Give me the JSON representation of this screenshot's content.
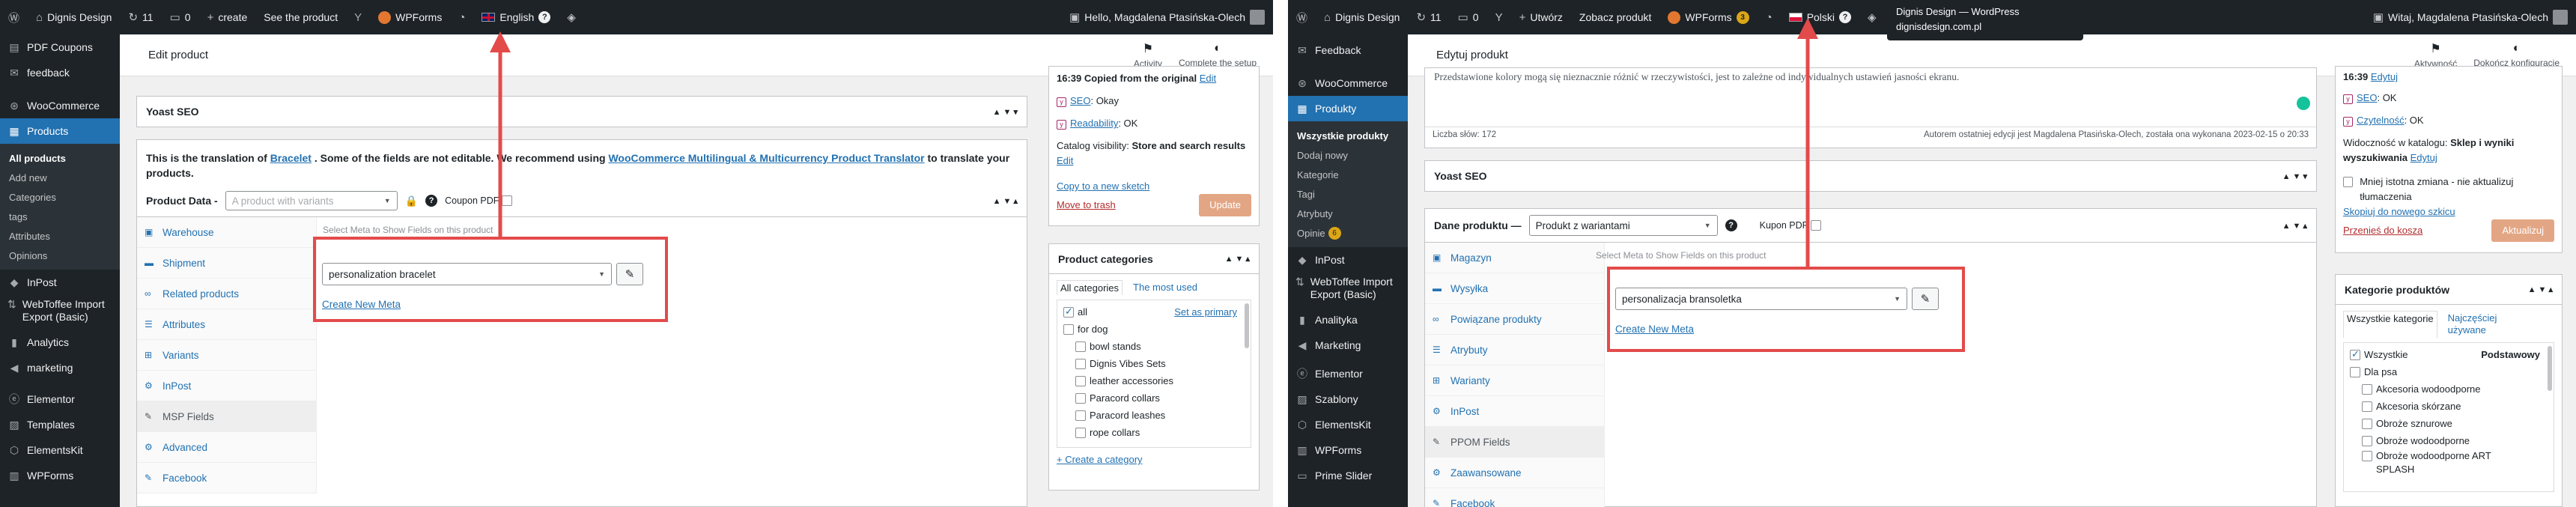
{
  "left": {
    "admin_bar": {
      "site": "Dignis Design",
      "updates": "11",
      "comments": "0",
      "new": "create",
      "view": "See the product",
      "wpforms": "WPForms",
      "language": "English",
      "greeting": "Hello, Magdalena Ptasińska-Olech"
    },
    "menu": {
      "items_top": [
        {
          "label": "PDF Coupons",
          "icon": "pdf-icon"
        },
        {
          "label": "feedback",
          "icon": "feedback-icon"
        },
        {
          "label": "WooCommerce",
          "icon": "woocommerce-icon"
        },
        {
          "label": "Products",
          "icon": "products-icon"
        }
      ],
      "submenu": [
        "All products",
        "Add new",
        "Categories",
        "tags",
        "Attributes",
        "Opinions"
      ],
      "items_bottom": [
        {
          "label": "InPost",
          "icon": "inpost-icon"
        },
        {
          "label": "WebToffee Import Export (Basic)",
          "icon": "import-export-icon"
        },
        {
          "label": "Analytics",
          "icon": "analytics-icon"
        },
        {
          "label": "marketing",
          "icon": "marketing-icon"
        },
        {
          "label": "Elementor",
          "icon": "elementor-icon"
        },
        {
          "label": "Templates",
          "icon": "templates-icon"
        },
        {
          "label": "ElementsKit",
          "icon": "elementskit-icon"
        },
        {
          "label": "WPForms",
          "icon": "wpforms-icon"
        }
      ]
    },
    "page_title": "Edit product",
    "activity": "Activity",
    "complete_setup": "Complete the setup",
    "yoast_title": "Yoast SEO",
    "translation_notice": {
      "before": "This is the translation of ",
      "link1": "Bracelet",
      "middle": " . Some of the fields are not editable. We recommend using ",
      "link2": "WooCommerce Multilingual & Multicurrency Product Translator",
      "after": " to translate your products."
    },
    "product_data_label": "Product Data -",
    "product_type": "A product with variants",
    "coupon_pdf": "Coupon PDF",
    "tabs": [
      "Warehouse",
      "Shipment",
      "Related products",
      "Attributes",
      "Variants",
      "InPost",
      "MSP Fields",
      "Advanced",
      "Facebook"
    ],
    "msp_hint": "Select Meta to Show Fields on this product",
    "meta_select": "personalization bracelet",
    "create_meta": "Create New Meta",
    "publish": {
      "copied": "16:39 Copied from the original",
      "edit": "Edit",
      "seo_label": "SEO",
      "seo_value": ": Okay",
      "readability_label": "Readability",
      "readability_value": ": OK",
      "catalog_visibility": "Catalog visibility:",
      "catalog_value": "Store and search results",
      "catalog_edit": "Edit",
      "copy_sketch": "Copy to a new sketch",
      "trash": "Move to trash",
      "update": "Update"
    },
    "categories": {
      "title": "Product categories",
      "tab_all": "All categories",
      "tab_used": "The most used",
      "set_primary": "Set as primary",
      "items": [
        {
          "label": "all",
          "checked": true,
          "level": 0
        },
        {
          "label": "for dog",
          "checked": false,
          "level": 0
        },
        {
          "label": "bowl stands",
          "checked": false,
          "level": 1
        },
        {
          "label": "Dignis Vibes Sets",
          "checked": false,
          "level": 1
        },
        {
          "label": "leather accessories",
          "checked": false,
          "level": 1
        },
        {
          "label": "Paracord collars",
          "checked": false,
          "level": 1
        },
        {
          "label": "Paracord leashes",
          "checked": false,
          "level": 1
        },
        {
          "label": "rope collars",
          "checked": false,
          "level": 1
        }
      ],
      "create": "+ Create a category"
    }
  },
  "right": {
    "admin_bar": {
      "site": "Dignis Design",
      "updates": "11",
      "comments": "0",
      "new": "Utwórz",
      "view": "Zobacz produkt",
      "wpforms": "WPForms",
      "wpforms_count": "3",
      "language": "Polski",
      "greeting": "Witaj, Magdalena Ptasińska-Olech"
    },
    "tooltip_title": "Dignis Design — WordPress",
    "tooltip_url": "dignisdesign.com.pl",
    "menu": {
      "items_top": [
        {
          "label": "Feedback",
          "icon": "feedback-icon"
        },
        {
          "label": "WooCommerce",
          "icon": "woocommerce-icon"
        },
        {
          "label": "Produkty",
          "icon": "products-icon"
        }
      ],
      "submenu": [
        "Wszystkie produkty",
        "Dodaj nowy",
        "Kategorie",
        "Tagi",
        "Atrybuty",
        "Opinie"
      ],
      "opinie_count": "6",
      "items_bottom": [
        {
          "label": "InPost",
          "icon": "inpost-icon"
        },
        {
          "label": "WebToffee Import Export (Basic)",
          "icon": "import-export-icon"
        },
        {
          "label": "Analityka",
          "icon": "analytics-icon"
        },
        {
          "label": "Marketing",
          "icon": "marketing-icon"
        },
        {
          "label": "Elementor",
          "icon": "elementor-icon"
        },
        {
          "label": "Szablony",
          "icon": "templates-icon"
        },
        {
          "label": "ElementsKit",
          "icon": "elementskit-icon"
        },
        {
          "label": "WPForms",
          "icon": "wpforms-icon"
        },
        {
          "label": "Prime Slider",
          "icon": "slider-icon"
        }
      ]
    },
    "page_title": "Edytuj produkt",
    "activity": "Aktywność",
    "complete_setup": "Dokończ konfigurację",
    "editor_text": "Przedstawione kolory mogą się nieznacznie różnić w rzeczywistości, jest to zależne od indywidualnych ustawień jasności ekranu.",
    "word_count": "Liczba słów: 172",
    "last_edit": "Autorem ostatniej edycji jest Magdalena Ptasińska-Olech, została ona wykonana 2023-02-15 o 20:33",
    "yoast_title": "Yoast SEO",
    "product_data_label": "Dane produktu —",
    "product_type": "Produkt z wariantami",
    "coupon_pdf": "Kupon PDF",
    "tabs": [
      "Magazyn",
      "Wysyłka",
      "Powiązane produkty",
      "Atrybuty",
      "Warianty",
      "InPost",
      "PPOM Fields",
      "Zaawansowane",
      "Facebook"
    ],
    "msp_hint": "Select Meta to Show Fields on this product",
    "meta_select": "personalizacja bransoletka",
    "create_meta": "Create New Meta",
    "publish": {
      "date": "16:39",
      "edit": "Edytuj",
      "seo_label": "SEO",
      "seo_value": ": OK",
      "readability_label": "Czytelność",
      "readability_value": ": OK",
      "catalog_visibility": "Widoczność w katalogu:",
      "catalog_value": "Sklep i wyniki wyszukiwania",
      "catalog_edit": "Edytuj",
      "minor_change": "Mniej istotna zmiana - nie aktualizuj tłumaczenia",
      "copy_sketch": "Skopiuj do nowego szkicu",
      "trash": "Przenieś do kosza",
      "update": "Aktualizuj"
    },
    "categories": {
      "title": "Kategorie produktów",
      "tab_all": "Wszystkie kategorie",
      "tab_used": "Najczęściej używane",
      "primary": "Podstawowy",
      "items": [
        {
          "label": "Wszystkie",
          "checked": true,
          "level": 0
        },
        {
          "label": "Dla psa",
          "checked": false,
          "level": 0
        },
        {
          "label": "Akcesoria wodoodporne",
          "checked": false,
          "level": 1
        },
        {
          "label": "Akcesoria skórzane",
          "checked": false,
          "level": 1
        },
        {
          "label": "Obroże sznurowe",
          "checked": false,
          "level": 1
        },
        {
          "label": "Obroże wodoodporne",
          "checked": false,
          "level": 1
        },
        {
          "label": "Obroże wodoodporne ART SPLASH",
          "checked": false,
          "level": 1
        }
      ]
    }
  },
  "highlight_color": "#e34b4b",
  "accent_color": "#2271b1"
}
